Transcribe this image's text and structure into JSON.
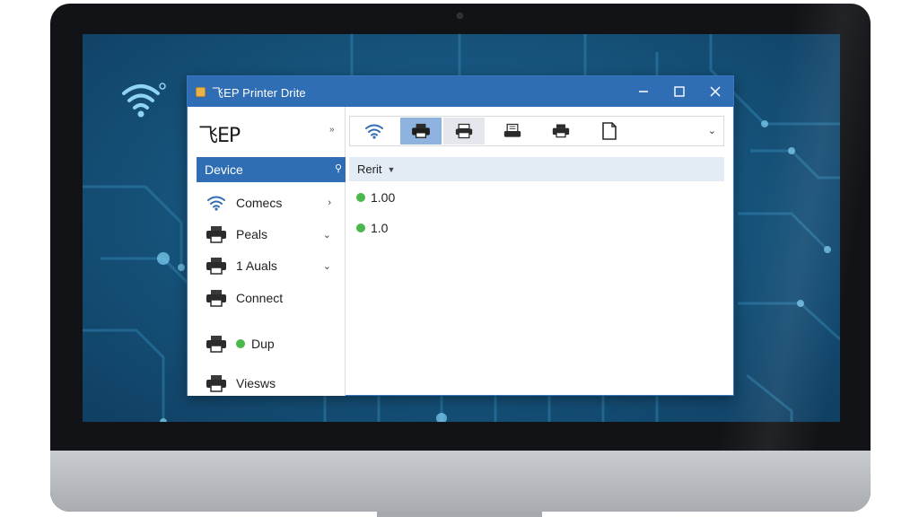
{
  "window": {
    "title": "飞EP Printer Drite",
    "minimize_icon": "minimize-icon",
    "maximize_icon": "maximize-icon",
    "close_icon": "close-icon"
  },
  "sidebar": {
    "logo": "飞EP",
    "collapse_icon": "double-chevron-icon",
    "selected": {
      "label": "Device",
      "icon": "pin-icon"
    },
    "items": [
      {
        "label": "Comecs",
        "icon": "wifi-icon",
        "chevron": "›"
      },
      {
        "label": "Peals",
        "icon": "printer-icon",
        "chevron": "⌄"
      },
      {
        "label": "1 Auals",
        "icon": "printer-icon",
        "chevron": "⌄"
      },
      {
        "label": "Connect",
        "icon": "printer-icon",
        "chevron": ""
      },
      {
        "label": "Dup",
        "icon": "printer-icon",
        "status": "online"
      },
      {
        "label": "Viesws",
        "icon": "printer-icon",
        "chevron": ""
      }
    ]
  },
  "toolbar": {
    "buttons": [
      "wifi-icon",
      "printer-icon",
      "printer-icon",
      "scanner-icon",
      "printer-icon",
      "document-icon"
    ],
    "dropdown_icon": "chevron-down-icon"
  },
  "content": {
    "header": "Rerit",
    "rows": [
      {
        "value": "1.00",
        "status": "online"
      },
      {
        "value": "1.0",
        "status": "online"
      }
    ]
  },
  "colors": {
    "accent": "#2f6db5",
    "status_online": "#4ab84a",
    "desktop": "#17567f"
  }
}
